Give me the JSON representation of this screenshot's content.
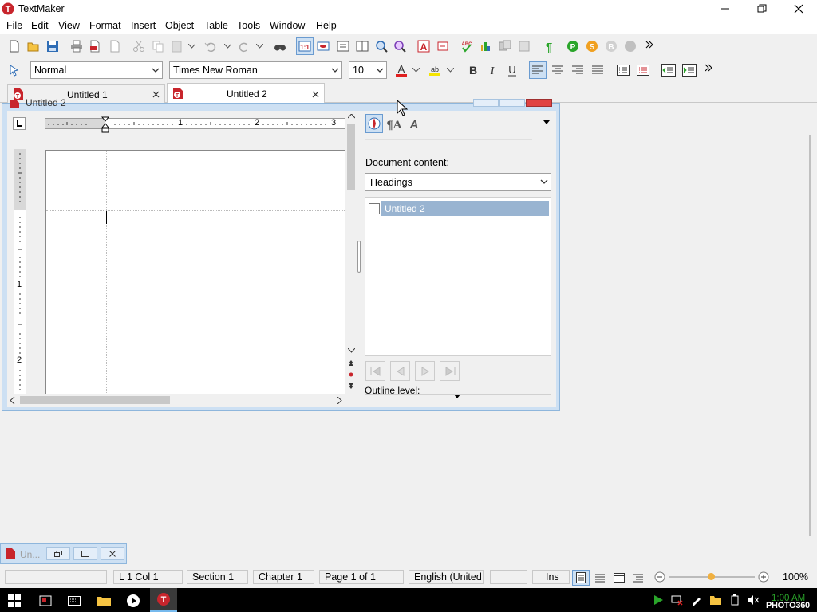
{
  "app": {
    "title": "TextMaker"
  },
  "menu": [
    "File",
    "Edit",
    "View",
    "Format",
    "Insert",
    "Object",
    "Table",
    "Tools",
    "Window",
    "Help"
  ],
  "format": {
    "style": "Normal",
    "font": "Times New Roman",
    "size": "10"
  },
  "tabs": [
    {
      "label": "Untitled 1"
    },
    {
      "label": "Untitled 2"
    }
  ],
  "docwin": {
    "title": "Untitled 2"
  },
  "ruler": {
    "h_labels": [
      "1",
      "2",
      "3"
    ],
    "v_labels": [
      "1",
      "2"
    ]
  },
  "sidebar": {
    "content_label": "Document content:",
    "content_value": "Headings",
    "outline_item": "Untitled 2",
    "outline_level_label": "Outline level:"
  },
  "minimized": {
    "label": "Un..."
  },
  "status": {
    "position": "L 1 Col 1",
    "section": "Section 1",
    "chapter": "Chapter 1",
    "page": "Page 1 of 1",
    "language": "English (United",
    "mode": "Ins",
    "zoom": "100%"
  },
  "taskbar": {
    "time": "1:00 AM",
    "watermark": "PHOTO360"
  },
  "colors": {
    "accent": "#0078d7",
    "doc_frame": "#cde0f3",
    "selection": "#99b4d1",
    "close_red": "#e04343"
  }
}
